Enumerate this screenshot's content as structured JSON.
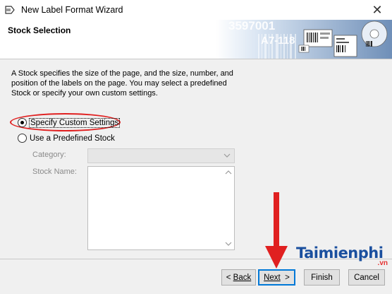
{
  "window": {
    "title": "New Label Format Wizard",
    "close_glyph": "✕"
  },
  "header": {
    "title": "Stock Selection",
    "art_numbers": [
      "3597001",
      "A7-118"
    ]
  },
  "description": "A Stock specifies the size of the page, and the size, number, and position of the labels on the page. You may select a predefined Stock or specify your own custom settings.",
  "options": {
    "custom": {
      "label": "Specify Custom Settings",
      "checked": true
    },
    "predefined": {
      "label": "Use a Predefined Stock",
      "checked": false
    }
  },
  "fields": {
    "category_label": "Category:",
    "stock_name_label": "Stock Name:"
  },
  "buttons": {
    "back": {
      "arrow": "<",
      "text": "Back"
    },
    "next": {
      "text": "Next",
      "arrow": ">"
    },
    "finish": "Finish",
    "cancel": "Cancel"
  },
  "watermark": {
    "text": "Taimienphi",
    "suffix": ".vn"
  },
  "colors": {
    "annotation": "#e02020",
    "default_button_border": "#0078d7",
    "watermark": "#1a4f9e"
  }
}
